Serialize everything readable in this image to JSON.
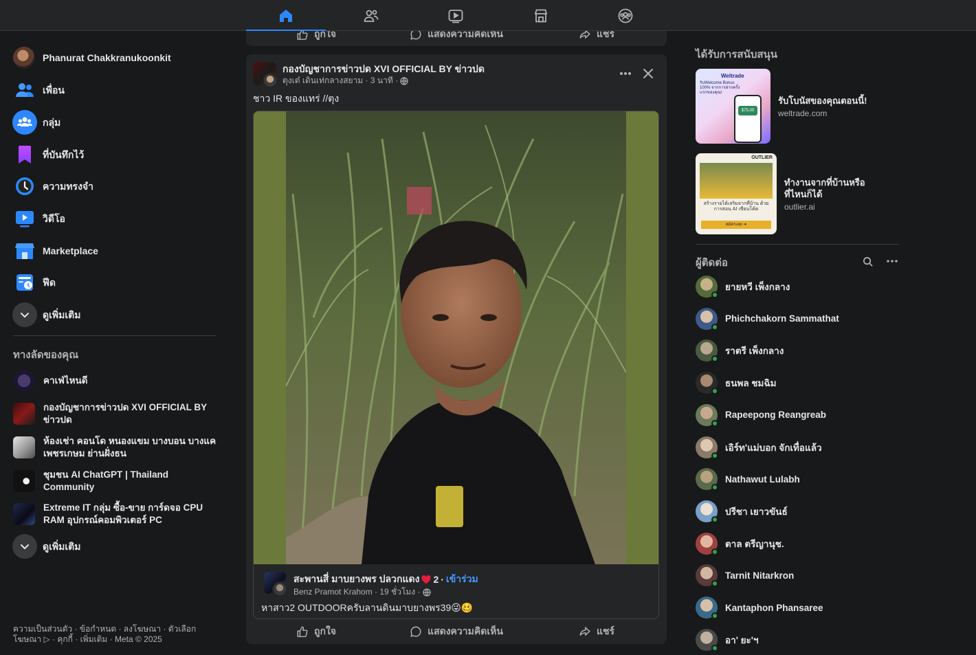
{
  "topnav": {
    "tabs": [
      {
        "name": "home",
        "active": true
      },
      {
        "name": "friends"
      },
      {
        "name": "watch"
      },
      {
        "name": "marketplace"
      },
      {
        "name": "groups"
      }
    ]
  },
  "sidebar": {
    "user": "Phanurat Chakkranukoonkit",
    "items": [
      {
        "label": "เพื่อน",
        "icon": "friends-icon"
      },
      {
        "label": "กลุ่ม",
        "icon": "groups-icon"
      },
      {
        "label": "ที่บันทึกไว้",
        "icon": "saved-icon"
      },
      {
        "label": "ความทรงจำ",
        "icon": "memories-icon"
      },
      {
        "label": "วิดีโอ",
        "icon": "video-icon"
      },
      {
        "label": "Marketplace",
        "icon": "marketplace-icon"
      },
      {
        "label": "ฟีด",
        "icon": "feed-icon"
      },
      {
        "label": "ดูเพิ่มเติม",
        "icon": "chevron-down-icon"
      }
    ],
    "shortcuts_title": "ทางลัดของคุณ",
    "shortcuts": [
      {
        "label": "คาเฟ่ไหนดี"
      },
      {
        "label": "กองบัญชาการข่าวปด XVI OFFICIAL BY ข่าวปด"
      },
      {
        "label": "ห้องเช่า คอนโด หนองแขม บางบอน บางแค เพชรเกษม ย่านฝั่งธน"
      },
      {
        "label": "ชุมชน AI ChatGPT | Thailand Community"
      },
      {
        "label": "Extreme IT กลุ่ม ซื้อ-ขาย การ์ดจอ CPU RAM อุปกรณ์คอมพิวเตอร์ PC"
      }
    ],
    "shortcuts_more": "ดูเพิ่มเติม",
    "footer": "ความเป็นส่วนตัว · ข้อกำหนด · ลงโฆษณา · ตัวเลือกโฆษณา ▷ · คุกกี้ · เพิ่มเติม · Meta © 2025"
  },
  "feed": {
    "prev_actions": {
      "like": "ถูกใจ",
      "comment": "แสดงความคิดเห็น",
      "share": "แชร์"
    },
    "post": {
      "page_name": "กองบัญชาการข่าวปด XVI OFFICIAL BY ข่าวปด",
      "author_line": "ตุงเต๋ เดินเท่กลางสยาม · 3 นาที ·",
      "caption": "ชาว IR ของแทร่ //ตุง",
      "shared": {
        "group_line": "สะพานสี่ มาบยางพร ปลวกแดง",
        "reaction_count": "2",
        "join": "เข้าร่วม",
        "author_line": "Benz Pramot Krahom · 19 ชั่วโมง ·",
        "text": "หาสาว2 OUTDOORครับลานดินมาบยางพร39😜🥴"
      },
      "actions": {
        "like": "ถูกใจ",
        "comment": "แสดงความคิดเห็น",
        "share": "แชร์"
      }
    }
  },
  "rightbar": {
    "sponsored_title": "ได้รับการสนับสนุน",
    "ads": [
      {
        "title": "รับโบนัสของคุณตอนนี้!",
        "domain": "weltrade.com",
        "img_text": "Weltrade",
        "img_sub": "รับWelcome Bonus 100% จากการฝากครั้งแรกของคุณ!",
        "img_amount": "$75.00"
      },
      {
        "title": "ทำงานจากที่บ้านหรือที่ไหนก็ได้",
        "domain": "outlier.ai",
        "img_text": "OUTLIER",
        "img_sub": "สร้างรายได้เสริมจากที่บ้าน ด้วยการสอน AI เขียนโค้ด",
        "img_btn": "สมัครเลย ➔"
      }
    ],
    "contacts_title": "ผู้ติดต่อ",
    "contacts": [
      {
        "name": "ยายหวี เพ็งกลาง"
      },
      {
        "name": "Phichchakorn Sammathat"
      },
      {
        "name": "ราตรี เพ็งกลาง"
      },
      {
        "name": "ธนพล ชมฉิม"
      },
      {
        "name": "Rapeepong Reangreab"
      },
      {
        "name": "เอิร์ท'แม่บอก จักเทื่อแล้ว"
      },
      {
        "name": "Nathawut Lulabh"
      },
      {
        "name": "ปรีชา เยาวขันธ์"
      },
      {
        "name": "ตาล ตรีญานุช."
      },
      {
        "name": "Tarnit Nitarkron"
      },
      {
        "name": "Kantaphon Phansaree"
      },
      {
        "name": "อา' ยะ'ฯ"
      }
    ]
  }
}
